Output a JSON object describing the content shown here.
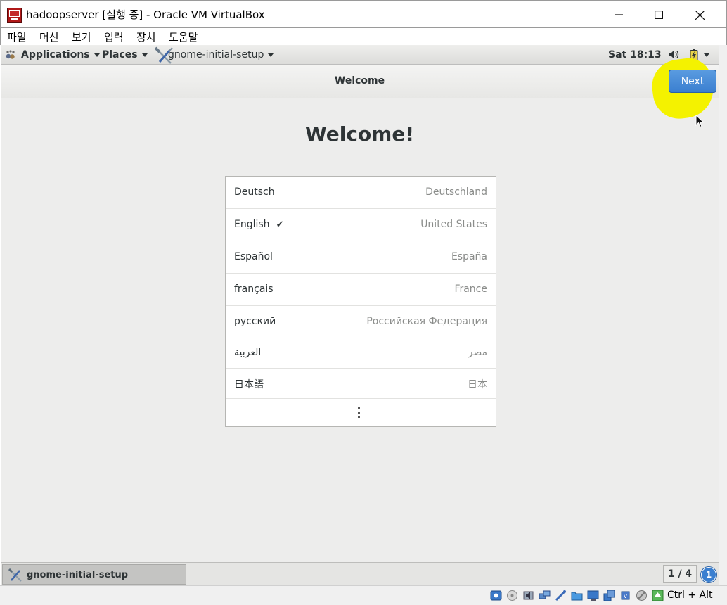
{
  "window": {
    "title": "hadoopserver [실행 중] - Oracle VM VirtualBox",
    "menu": [
      "파일",
      "머신",
      "보기",
      "입력",
      "장치",
      "도움말"
    ]
  },
  "gnome_panel": {
    "applications": "Applications",
    "places": "Places",
    "current_app": "gnome-initial-setup",
    "clock": "Sat 18:13"
  },
  "setup": {
    "header_title": "Welcome",
    "next_label": "Next",
    "heading": "Welcome!",
    "languages": [
      {
        "name": "Deutsch",
        "region": "Deutschland",
        "selected": false
      },
      {
        "name": "English",
        "region": "United States",
        "selected": true
      },
      {
        "name": "Español",
        "region": "España",
        "selected": false
      },
      {
        "name": "français",
        "region": "France",
        "selected": false
      },
      {
        "name": "русский",
        "region": "Российская Федерация",
        "selected": false
      },
      {
        "name": "العربية",
        "region": "مصر",
        "selected": false
      },
      {
        "name": "日本語",
        "region": "日本",
        "selected": false
      }
    ],
    "check_glyph": "✔"
  },
  "taskbar": {
    "task_label": "gnome-initial-setup",
    "workspace": "1 / 4",
    "notification_count": "1"
  },
  "statusbar": {
    "host_key": "Ctrl + Alt"
  }
}
